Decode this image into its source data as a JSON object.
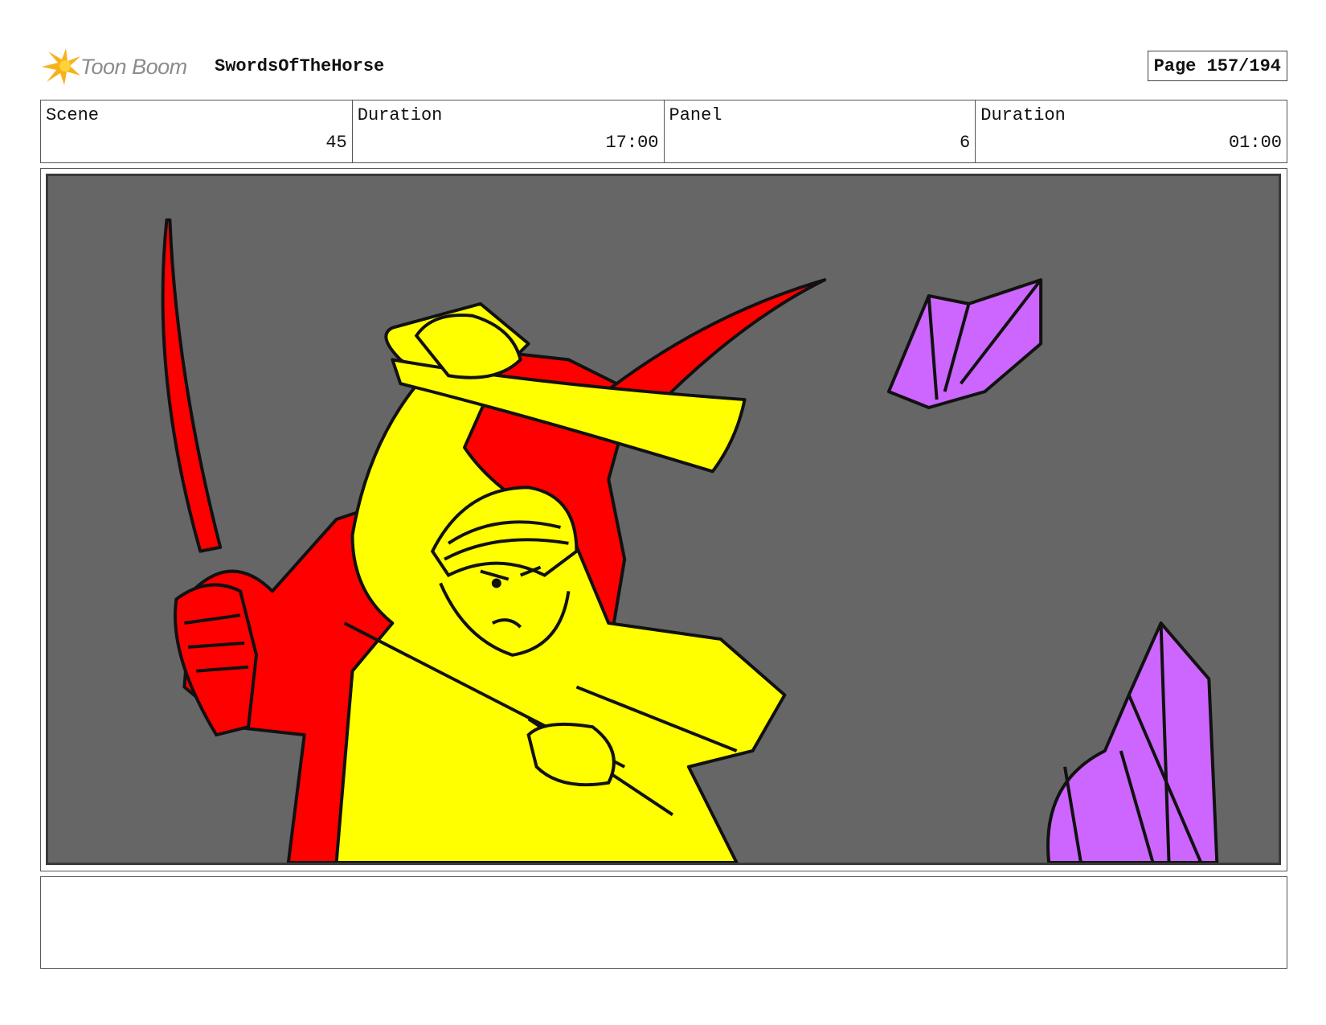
{
  "header": {
    "logo_text": "Toon Boom",
    "project_title": "SwordsOfTheHorse",
    "page_label": "Page 157/194"
  },
  "info": {
    "scene_label": "Scene",
    "scene_value": "45",
    "duration_label": "Duration",
    "duration_value": "17:00",
    "panel_label": "Panel",
    "panel_value": "6",
    "panel_duration_label": "Duration",
    "panel_duration_value": "01:00"
  },
  "panel_colors": {
    "background": "#666666",
    "enemy": "#ff0000",
    "hero": "#ffff00",
    "crystal": "#cc66ff",
    "ink": "#111111"
  },
  "notes": {
    "text": ""
  }
}
